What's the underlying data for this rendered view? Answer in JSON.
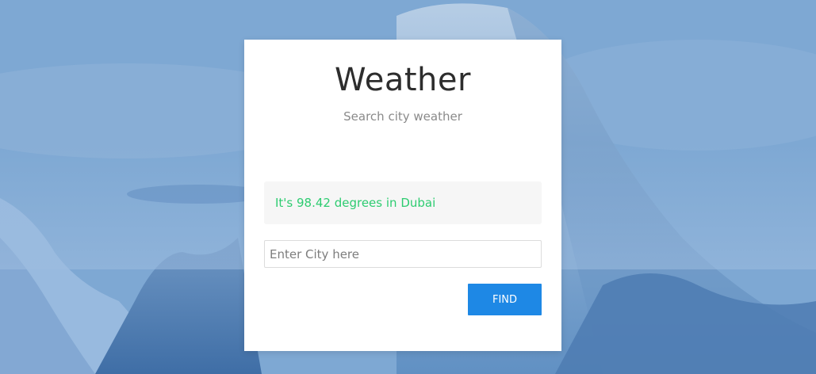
{
  "app": {
    "title": "Weather",
    "subtitle": "Search city weather"
  },
  "result": {
    "message": "It's 98.42 degrees in Dubai"
  },
  "search": {
    "placeholder": "Enter City here",
    "value": ""
  },
  "actions": {
    "find_label": "FIND"
  },
  "colors": {
    "accent": "#1e88e5",
    "success_text": "#2ecc71",
    "background_tint": "#6e9ccb"
  }
}
